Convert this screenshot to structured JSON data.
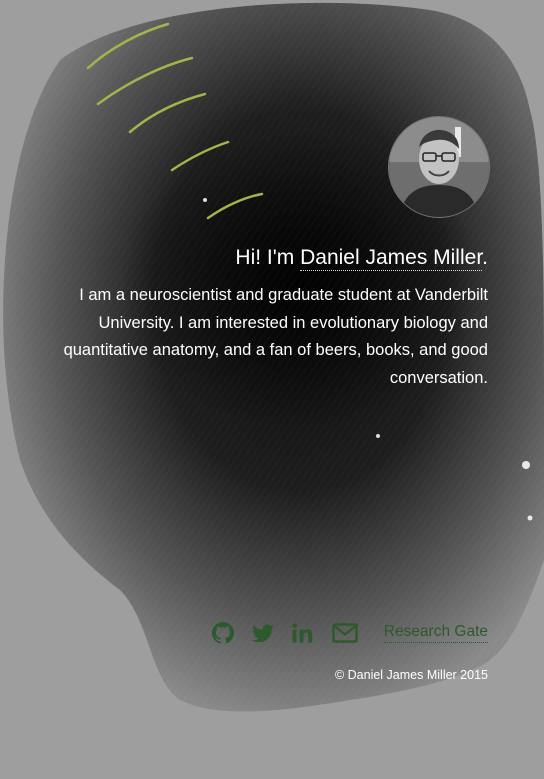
{
  "profile": {
    "greeting_prefix": "Hi! I'm ",
    "name": "Daniel James Miller",
    "greeting_suffix": ".",
    "bio": "I am a neuroscientist and graduate student at Vanderbilt University. I am interested in evolutionary biology and quantitative anatomy, and a fan of beers, books, and good conversation."
  },
  "links": {
    "icons": [
      "github-icon",
      "twitter-icon",
      "linkedin-icon",
      "mail-icon"
    ],
    "research_gate_label": "Research Gate"
  },
  "footer": {
    "copyright": "© Daniel James Miller 2015"
  },
  "colors": {
    "background": "#9e9e9e",
    "link_green": "#2d5a2d",
    "text": "#ffffff"
  }
}
